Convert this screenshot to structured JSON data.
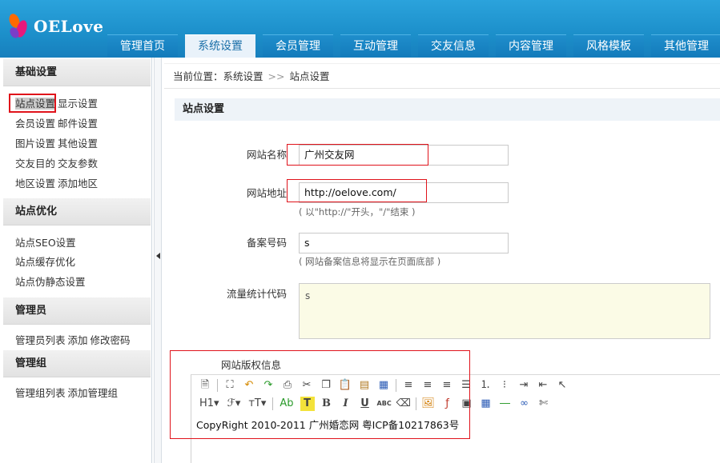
{
  "app": {
    "logo_text": "OELove"
  },
  "nav": {
    "tabs": [
      {
        "label": "管理首页"
      },
      {
        "label": "系统设置"
      },
      {
        "label": "会员管理"
      },
      {
        "label": "互动管理"
      },
      {
        "label": "交友信息"
      },
      {
        "label": "内容管理"
      },
      {
        "label": "风格模板"
      },
      {
        "label": "其他管理"
      }
    ],
    "active_index": 1
  },
  "sidebar": {
    "groups": [
      {
        "title": "基础设置",
        "rows": [
          [
            "站点设置",
            "显示设置"
          ],
          [
            "会员设置",
            "邮件设置"
          ],
          [
            "图片设置",
            "其他设置"
          ],
          [
            "交友目的",
            "交友参数"
          ],
          [
            "地区设置",
            "添加地区"
          ]
        ]
      },
      {
        "title": "站点优化",
        "rows": [
          [
            "站点SEO设置"
          ],
          [
            "站点缓存优化"
          ],
          [
            "站点伪静态设置"
          ]
        ]
      },
      {
        "title": "管理员",
        "rows": [
          [
            "管理员列表",
            "添加",
            "修改密码"
          ]
        ]
      },
      {
        "title": "管理组",
        "rows": [
          [
            "管理组列表",
            "添加管理组"
          ]
        ]
      }
    ]
  },
  "breadcrumb": {
    "prefix": "当前位置：",
    "parent": "系统设置",
    "sep": ">>",
    "current": "站点设置"
  },
  "section": {
    "title": "站点设置"
  },
  "form": {
    "site_name": {
      "label": "网站名称",
      "value": "广州交友网"
    },
    "site_url": {
      "label": "网站地址",
      "value": "http://oelove.com/",
      "hint": "( 以\"http://\"开头，\"/\"结束 )"
    },
    "icp": {
      "label": "备案号码",
      "value": "s",
      "hint": "( 网站备案信息将显示在页面底部 )"
    },
    "stat_code": {
      "label": "流量统计代码",
      "value": "s"
    },
    "copyright": {
      "label": "网站版权信息",
      "value": "CopyRight 2010-2011   广州婚恋网 粤ICP备10217863号"
    }
  },
  "editor": {
    "row1": [
      "source-icon",
      "fullscreen-icon",
      "undo-icon",
      "redo-icon",
      "print-icon",
      "cut-icon",
      "copy-icon",
      "paste-icon",
      "paste-text-icon",
      "paste-word-icon",
      "align-left-icon",
      "align-center-icon",
      "align-right-icon",
      "justify-icon",
      "ordered-list-icon",
      "unordered-list-icon",
      "indent-icon",
      "outdent-icon",
      "select-all-icon"
    ],
    "row2_labels": {
      "heading": "H1",
      "font": "ℱ",
      "size": "тT",
      "color": "Ab",
      "bgcolor": "T",
      "bold": "B",
      "italic": "I",
      "underline": "U",
      "strike": "ABC"
    },
    "row2_icons": [
      "eraser-icon",
      "image-icon",
      "flash-icon",
      "media-icon",
      "table-icon",
      "hr-icon",
      "link-icon",
      "unlink-icon"
    ]
  }
}
